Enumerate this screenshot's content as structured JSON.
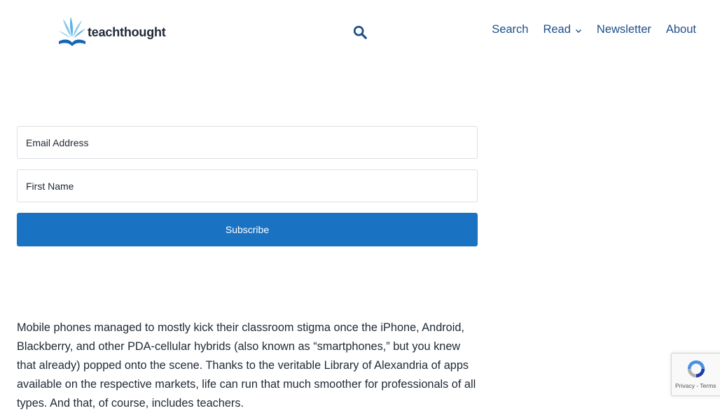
{
  "header": {
    "logo_text": "teachthought",
    "nav": [
      {
        "label": "Search"
      },
      {
        "label": "Read"
      },
      {
        "label": "Newsletter"
      },
      {
        "label": "About"
      }
    ]
  },
  "form": {
    "email_placeholder": "Email Address",
    "first_name_placeholder": "First Name",
    "subscribe_label": "Subscribe"
  },
  "article": {
    "paragraph": "Mobile phones managed to mostly kick their classroom stigma once the iPhone, Android, Blackberry, and other PDA-cellular hybrids (also known as “smartphones,” but you knew that already) popped onto the scene. Thanks to the veritable Library of Alexandria of apps available on the respective markets, life can run that much smoother for professionals of all types. And that, of course, includes teachers."
  },
  "recaptcha": {
    "links": "Privacy - Terms"
  },
  "colors": {
    "accent": "#1a73c2",
    "nav_text": "#1f4e8c",
    "body_text": "#1f2933"
  },
  "icons": {
    "logo": "teachthought-logo-icon",
    "search": "search-icon",
    "dropdown": "chevron-down-icon",
    "recaptcha": "recaptcha-icon"
  }
}
